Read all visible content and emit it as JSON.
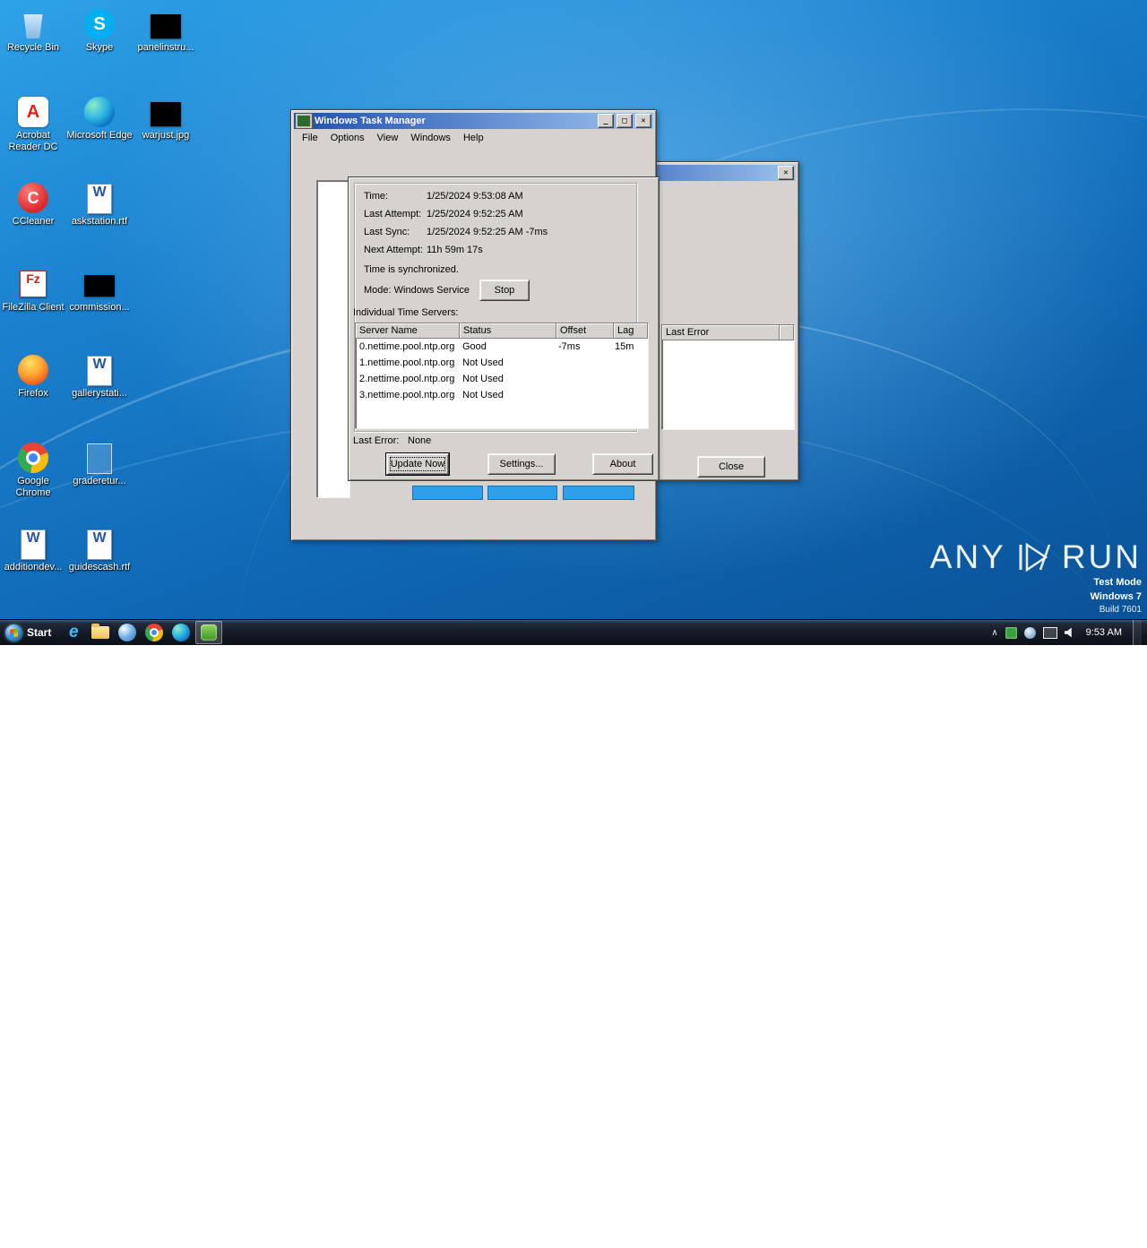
{
  "desktop": {
    "icons": [
      {
        "label": "Recycle Bin"
      },
      {
        "label": "Skype"
      },
      {
        "label": "panelinstru..."
      },
      {
        "label": "Acrobat Reader DC"
      },
      {
        "label": "Microsoft Edge"
      },
      {
        "label": "warjust.jpg"
      },
      {
        "label": "CCleaner"
      },
      {
        "label": "askstation.rtf"
      },
      {
        "label": "FileZilla Client"
      },
      {
        "label": "commission..."
      },
      {
        "label": "Firefox"
      },
      {
        "label": "gallerystati..."
      },
      {
        "label": "Google Chrome"
      },
      {
        "label": "graderetur..."
      },
      {
        "label": "additiondev..."
      },
      {
        "label": "guidescash.rtf"
      }
    ]
  },
  "taskmgr": {
    "title": "Windows Task Manager",
    "menu": [
      "File",
      "Options",
      "View",
      "Windows",
      "Help"
    ],
    "glyphs": {
      "minimize": "_",
      "maximize": "□",
      "close": "✕"
    }
  },
  "time_dialog": {
    "rows": [
      {
        "label": "Time:",
        "value": "1/25/2024 9:53:08 AM"
      },
      {
        "label": "Last Attempt:",
        "value": "1/25/2024 9:52:25 AM"
      },
      {
        "label": "Last Sync:",
        "value": "1/25/2024 9:52:25 AM -7ms"
      },
      {
        "label": "Next Attempt:",
        "value": "11h 59m 17s"
      }
    ],
    "sync_status": "Time is synchronized.",
    "mode": "Mode: Windows Service",
    "stop_button": "Stop",
    "servers_label": "Individual Time Servers:",
    "columns": [
      "Server Name",
      "Status",
      "Offset",
      "Lag"
    ],
    "servers": [
      [
        "0.nettime.pool.ntp.org",
        "Good",
        "-7ms",
        "15m"
      ],
      [
        "1.nettime.pool.ntp.org",
        "Not Used",
        "",
        ""
      ],
      [
        "2.nettime.pool.ntp.org",
        "Not Used",
        "",
        ""
      ],
      [
        "3.nettime.pool.ntp.org",
        "Not Used",
        "",
        ""
      ]
    ],
    "last_error_label": "Last Error:",
    "last_error_value": "None",
    "update_button": "Update Now",
    "settings_button": "Settings...",
    "about_button": "About"
  },
  "back_window": {
    "last_error_column": "Last Error",
    "close_button": "Close",
    "close_glyph": "✕"
  },
  "taskbar": {
    "start": "Start",
    "clock": "9:53 AM"
  },
  "watermark": {
    "any": "ANY",
    "run": "RUN",
    "line1": "Test Mode",
    "line2": "Windows 7",
    "line3": "Build 7601"
  },
  "colors": {
    "title_gradient_left": "#1e4fb0",
    "title_gradient_right": "#9ec3ee",
    "window_face": "#d6d3ce",
    "progress_blue": "#2da0e8",
    "desktop_blue": "#1b82cf"
  }
}
